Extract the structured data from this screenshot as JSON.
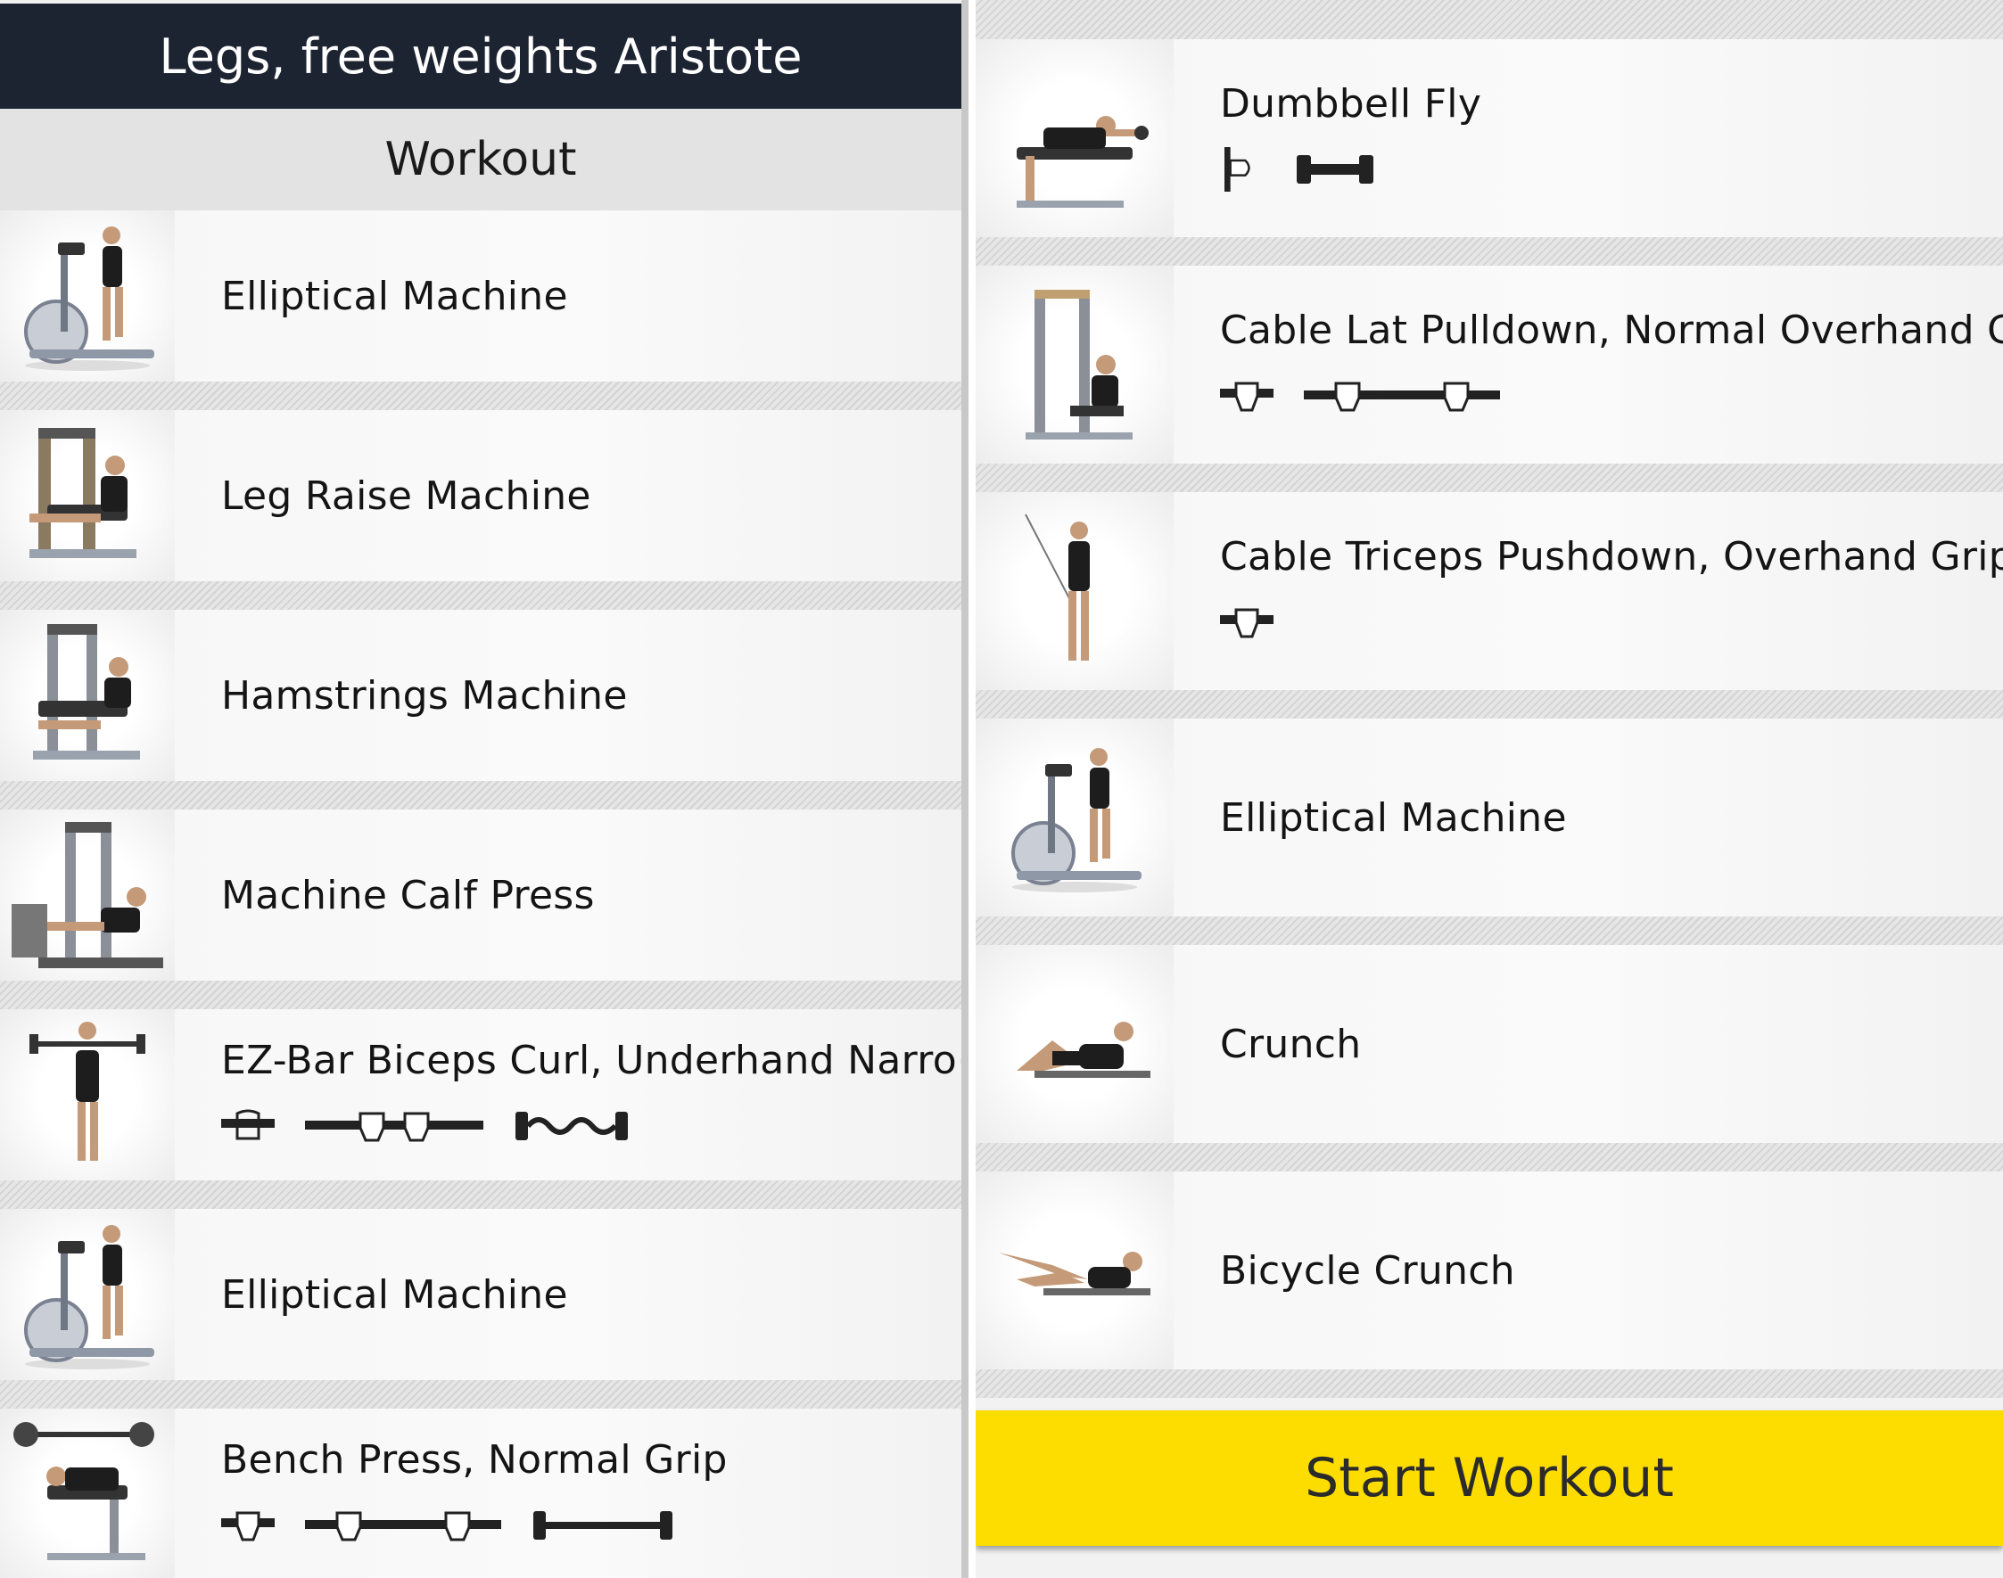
{
  "header": {
    "title": "Legs, free weights Aristote"
  },
  "section": {
    "title": "Workout"
  },
  "left_exercises": [
    {
      "name": "Elliptical Machine",
      "image": "elliptical-machine-image",
      "equipment": []
    },
    {
      "name": "Leg Raise Machine",
      "image": "leg-raise-machine-image",
      "equipment": []
    },
    {
      "name": "Hamstrings Machine",
      "image": "hamstrings-machine-image",
      "equipment": []
    },
    {
      "name": "Machine Calf Press",
      "image": "calf-press-image",
      "equipment": []
    },
    {
      "name": "EZ-Bar Biceps Curl, Underhand Narro⋯",
      "image": "ez-bar-curl-image",
      "equipment": [
        "underhand-grip-icon",
        "narrow-grip-icon",
        "ez-bar-icon"
      ]
    },
    {
      "name": "Elliptical Machine",
      "image": "elliptical-machine-image",
      "equipment": []
    },
    {
      "name": "Bench Press, Normal Grip",
      "image": "bench-press-image",
      "equipment": [
        "overhand-grip-icon",
        "normal-grip-icon",
        "barbell-icon"
      ]
    }
  ],
  "right_exercises": [
    {
      "name": "Dumbbell Fly",
      "image": "dumbbell-fly-image",
      "equipment": [
        "neutral-grip-icon",
        "dumbbell-icon"
      ]
    },
    {
      "name": "Cable Lat Pulldown, Normal Overhand Grip",
      "image": "lat-pulldown-image",
      "equipment": [
        "overhand-grip-icon",
        "normal-grip-icon"
      ]
    },
    {
      "name": "Cable Triceps Pushdown, Overhand Grip",
      "image": "triceps-pushdown-image",
      "equipment": [
        "overhand-grip-icon"
      ]
    },
    {
      "name": "Elliptical Machine",
      "image": "elliptical-machine-image",
      "equipment": []
    },
    {
      "name": "Crunch",
      "image": "crunch-image",
      "equipment": []
    },
    {
      "name": "Bicycle Crunch",
      "image": "bicycle-crunch-image",
      "equipment": []
    }
  ],
  "start_button": {
    "label": "Start Workout"
  },
  "colors": {
    "header_bg": "#1c2331",
    "button_bg": "#fddc00"
  }
}
